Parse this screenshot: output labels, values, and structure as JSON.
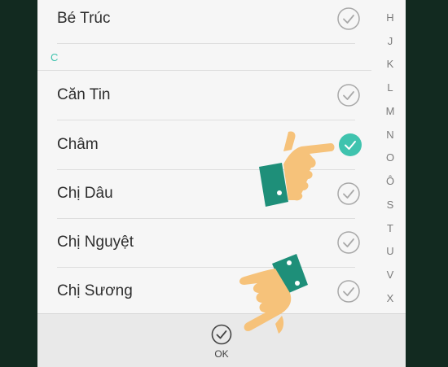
{
  "contacts_before": [
    {
      "name": "Bé Trúc",
      "checked": false
    }
  ],
  "section_header": "C",
  "contacts": [
    {
      "name": "Căn Tin",
      "checked": false
    },
    {
      "name": "Châm",
      "checked": true
    },
    {
      "name": "Chị Dâu",
      "checked": false
    },
    {
      "name": "Chị Nguyệt",
      "checked": false
    },
    {
      "name": "Chị Sương",
      "checked": false
    }
  ],
  "index_letters": [
    "H",
    "J",
    "K",
    "L",
    "M",
    "N",
    "O",
    "Ô",
    "S",
    "T",
    "U",
    "V",
    "X"
  ],
  "bottom_bar": {
    "ok_label": "OK"
  },
  "colors": {
    "accent": "#3fc3ae",
    "sleeve": "#1e8f79",
    "hand": "#f6c27a"
  }
}
